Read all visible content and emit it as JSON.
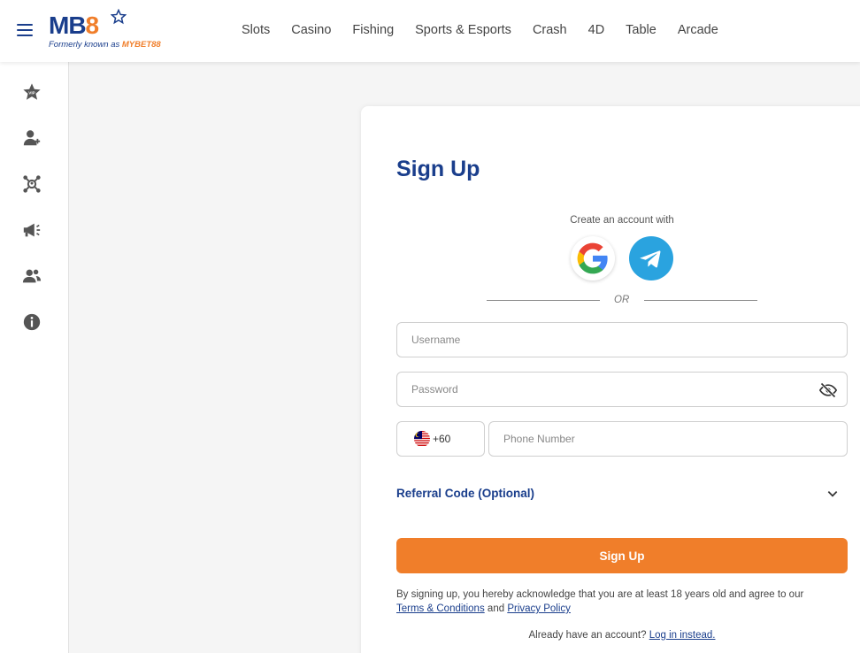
{
  "brand": {
    "logo_main_mb": "MB",
    "logo_main_8": "8",
    "tagline_prefix": "Formerly known as ",
    "tagline_brand": "MYBET88",
    "primary_color": "#1a3e8c",
    "accent_color": "#f07e2a"
  },
  "nav": {
    "items": [
      "Slots",
      "Casino",
      "Fishing",
      "Sports & Esports",
      "Crash",
      "4D",
      "Table",
      "Arcade"
    ]
  },
  "sidebar": {
    "icons": [
      "vip-star-icon",
      "user-add-icon",
      "referral-network-icon",
      "megaphone-icon",
      "users-icon",
      "info-icon"
    ]
  },
  "signup": {
    "title": "Sign Up",
    "create_with": "Create an account with",
    "social": [
      "google-icon",
      "telegram-icon"
    ],
    "or": "OR",
    "username_placeholder": "Username",
    "password_placeholder": "Password",
    "country_code": "+60",
    "phone_placeholder": "Phone Number",
    "referral_label": "Referral Code (Optional)",
    "submit_label": "Sign Up",
    "terms_text": "By signing up, you hereby acknowledge that you are at least 18 years old and agree to our",
    "terms_link": "Terms & Conditions",
    "terms_and": "and",
    "privacy_link": "Privacy Policy",
    "login_prompt": "Already have an account?",
    "login_link": "Log in instead."
  }
}
